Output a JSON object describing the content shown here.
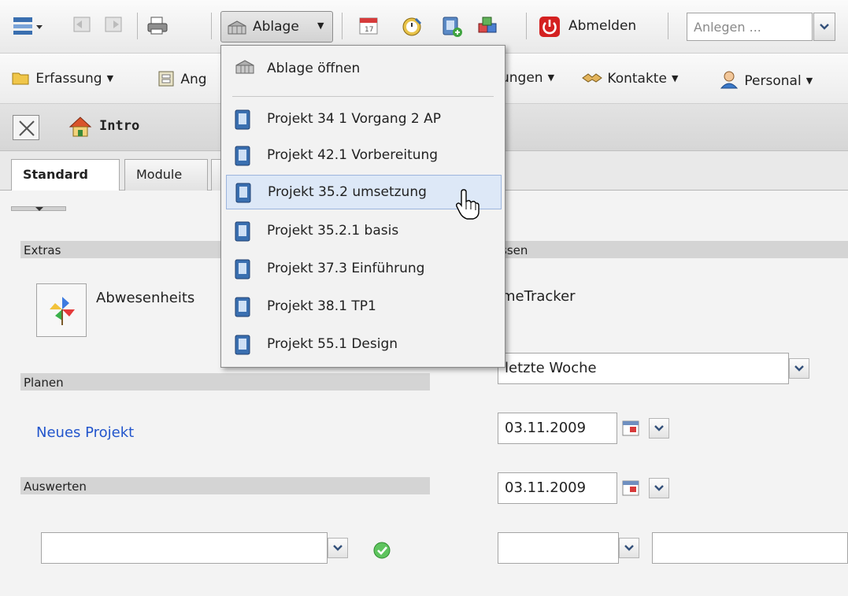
{
  "toolbar": {
    "ablage_label": "Ablage",
    "abmelden_label": "Abmelden",
    "anlegen_placeholder": "Anlegen ..."
  },
  "menubar": {
    "items": [
      {
        "label": "Erfassung"
      },
      {
        "label": "Ang"
      },
      {
        "label": "ungen"
      },
      {
        "label": "Kontakte"
      },
      {
        "label": "Personal"
      }
    ]
  },
  "titlebar": {
    "title": "Intro"
  },
  "tabs": [
    {
      "label": "Standard",
      "active": true
    },
    {
      "label": "Module",
      "active": false
    }
  ],
  "dropdown": {
    "open_label": "Ablage öffnen",
    "items": [
      {
        "label": "Projekt 34 1 Vorgang 2 AP"
      },
      {
        "label": "Projekt 42.1 Vorbereitung"
      },
      {
        "label": "Projekt 35.2 umsetzung",
        "hovered": true
      },
      {
        "label": "Projekt 35.2.1 basis"
      },
      {
        "label": "Projekt 37.3 Einführung"
      },
      {
        "label": "Projekt 38.1 TP1"
      },
      {
        "label": "Projekt 55.1 Design"
      }
    ]
  },
  "left": {
    "extras_title": "Extras",
    "abwesenheit_label": "Abwesenheits",
    "planen_title": "Planen",
    "neues_projekt": "Neues Projekt",
    "auswerten_title": "Auswerten",
    "auswerten_select_value": ""
  },
  "right": {
    "section_title": "ssen",
    "timetracker_label": "imeTracker",
    "period_value": "letzte Woche",
    "date_from": "03.11.2009",
    "date_to": "03.11.2009",
    "bottom_select_value": "",
    "bottom_input_value": ""
  },
  "colors": {
    "link": "#2255cc",
    "logout_red": "#d42121",
    "hover_bg": "#dde8f7",
    "book_blue": "#3a6fb0"
  }
}
